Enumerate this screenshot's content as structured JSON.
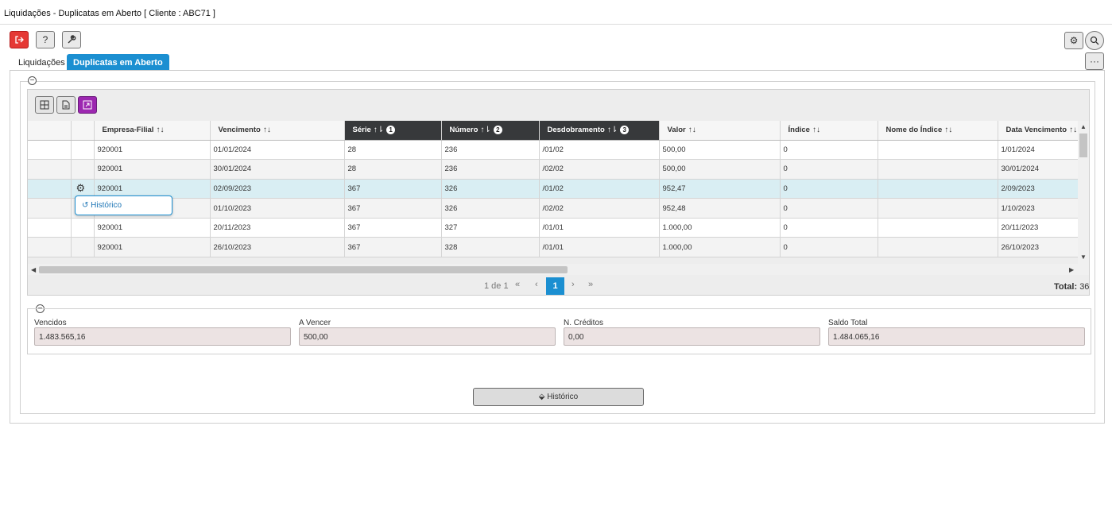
{
  "window": {
    "title": "Liquidações - Duplicatas em Aberto [ Cliente : ABC71 ]"
  },
  "toolbar": {
    "exit_icon": "exit-icon",
    "help_label": "?",
    "tools_icon": "wrench-icon",
    "settings_icon": "gear-icon",
    "search_icon": "search-icon",
    "more_label": "···"
  },
  "tabs": [
    {
      "label": "Liquidações",
      "active": false
    },
    {
      "label": "Duplicatas em Aberto",
      "active": true
    }
  ],
  "grid": {
    "columns": [
      {
        "label": "",
        "sort": "",
        "order": ""
      },
      {
        "label": "",
        "sort": "",
        "order": ""
      },
      {
        "label": "Empresa-Filial",
        "sort": "↑↓",
        "order": ""
      },
      {
        "label": "Vencimento",
        "sort": "↑↓",
        "order": ""
      },
      {
        "label": "Série",
        "sort": "↑⇂",
        "order": "1"
      },
      {
        "label": "Número",
        "sort": "↑⇂",
        "order": "2"
      },
      {
        "label": "Desdobramento",
        "sort": "↑⇂",
        "order": "3"
      },
      {
        "label": "Valor",
        "sort": "↑↓",
        "order": ""
      },
      {
        "label": "Índice",
        "sort": "↑↓",
        "order": ""
      },
      {
        "label": "Nome do Índice",
        "sort": "↑↓",
        "order": ""
      },
      {
        "label": "Data Vencimento",
        "sort": "↑↓",
        "order": ""
      }
    ],
    "rows": [
      [
        "",
        "",
        "920001",
        "01/01/2024",
        "28",
        "236",
        "/01/02",
        "500,00",
        "0",
        "",
        "1/01/2024"
      ],
      [
        "",
        "",
        "920001",
        "30/01/2024",
        "28",
        "236",
        "/02/02",
        "500,00",
        "0",
        "",
        "30/01/2024"
      ],
      [
        "",
        "",
        "920001",
        "02/09/2023",
        "367",
        "326",
        "/01/02",
        "952,47",
        "0",
        "",
        "2/09/2023"
      ],
      [
        "",
        "",
        "",
        "01/10/2023",
        "367",
        "326",
        "/02/02",
        "952,48",
        "0",
        "",
        "1/10/2023"
      ],
      [
        "",
        "",
        "920001",
        "20/11/2023",
        "367",
        "327",
        "/01/01",
        "1.000,00",
        "0",
        "",
        "20/11/2023"
      ],
      [
        "",
        "",
        "920001",
        "26/10/2023",
        "367",
        "328",
        "/01/01",
        "1.000,00",
        "0",
        "",
        "26/10/2023"
      ]
    ],
    "selected_row": 2,
    "context_menu": {
      "label": "Histórico",
      "icon": "history-icon"
    }
  },
  "pager": {
    "info": "1 de 1",
    "first": "«",
    "prev": "‹",
    "current": "1",
    "next": "›",
    "last": "»",
    "total_label": "Total:",
    "total_value": "36"
  },
  "summary": {
    "vencidos": {
      "label": "Vencidos",
      "value": "1.483.565,16"
    },
    "a_vencer": {
      "label": "A Vencer",
      "value": "500,00"
    },
    "n_creditos": {
      "label": "N. Créditos",
      "value": "0,00"
    },
    "saldo_total": {
      "label": "Saldo Total",
      "value": "1.484.065,16"
    }
  },
  "footer": {
    "historico_button": "Histórico"
  }
}
